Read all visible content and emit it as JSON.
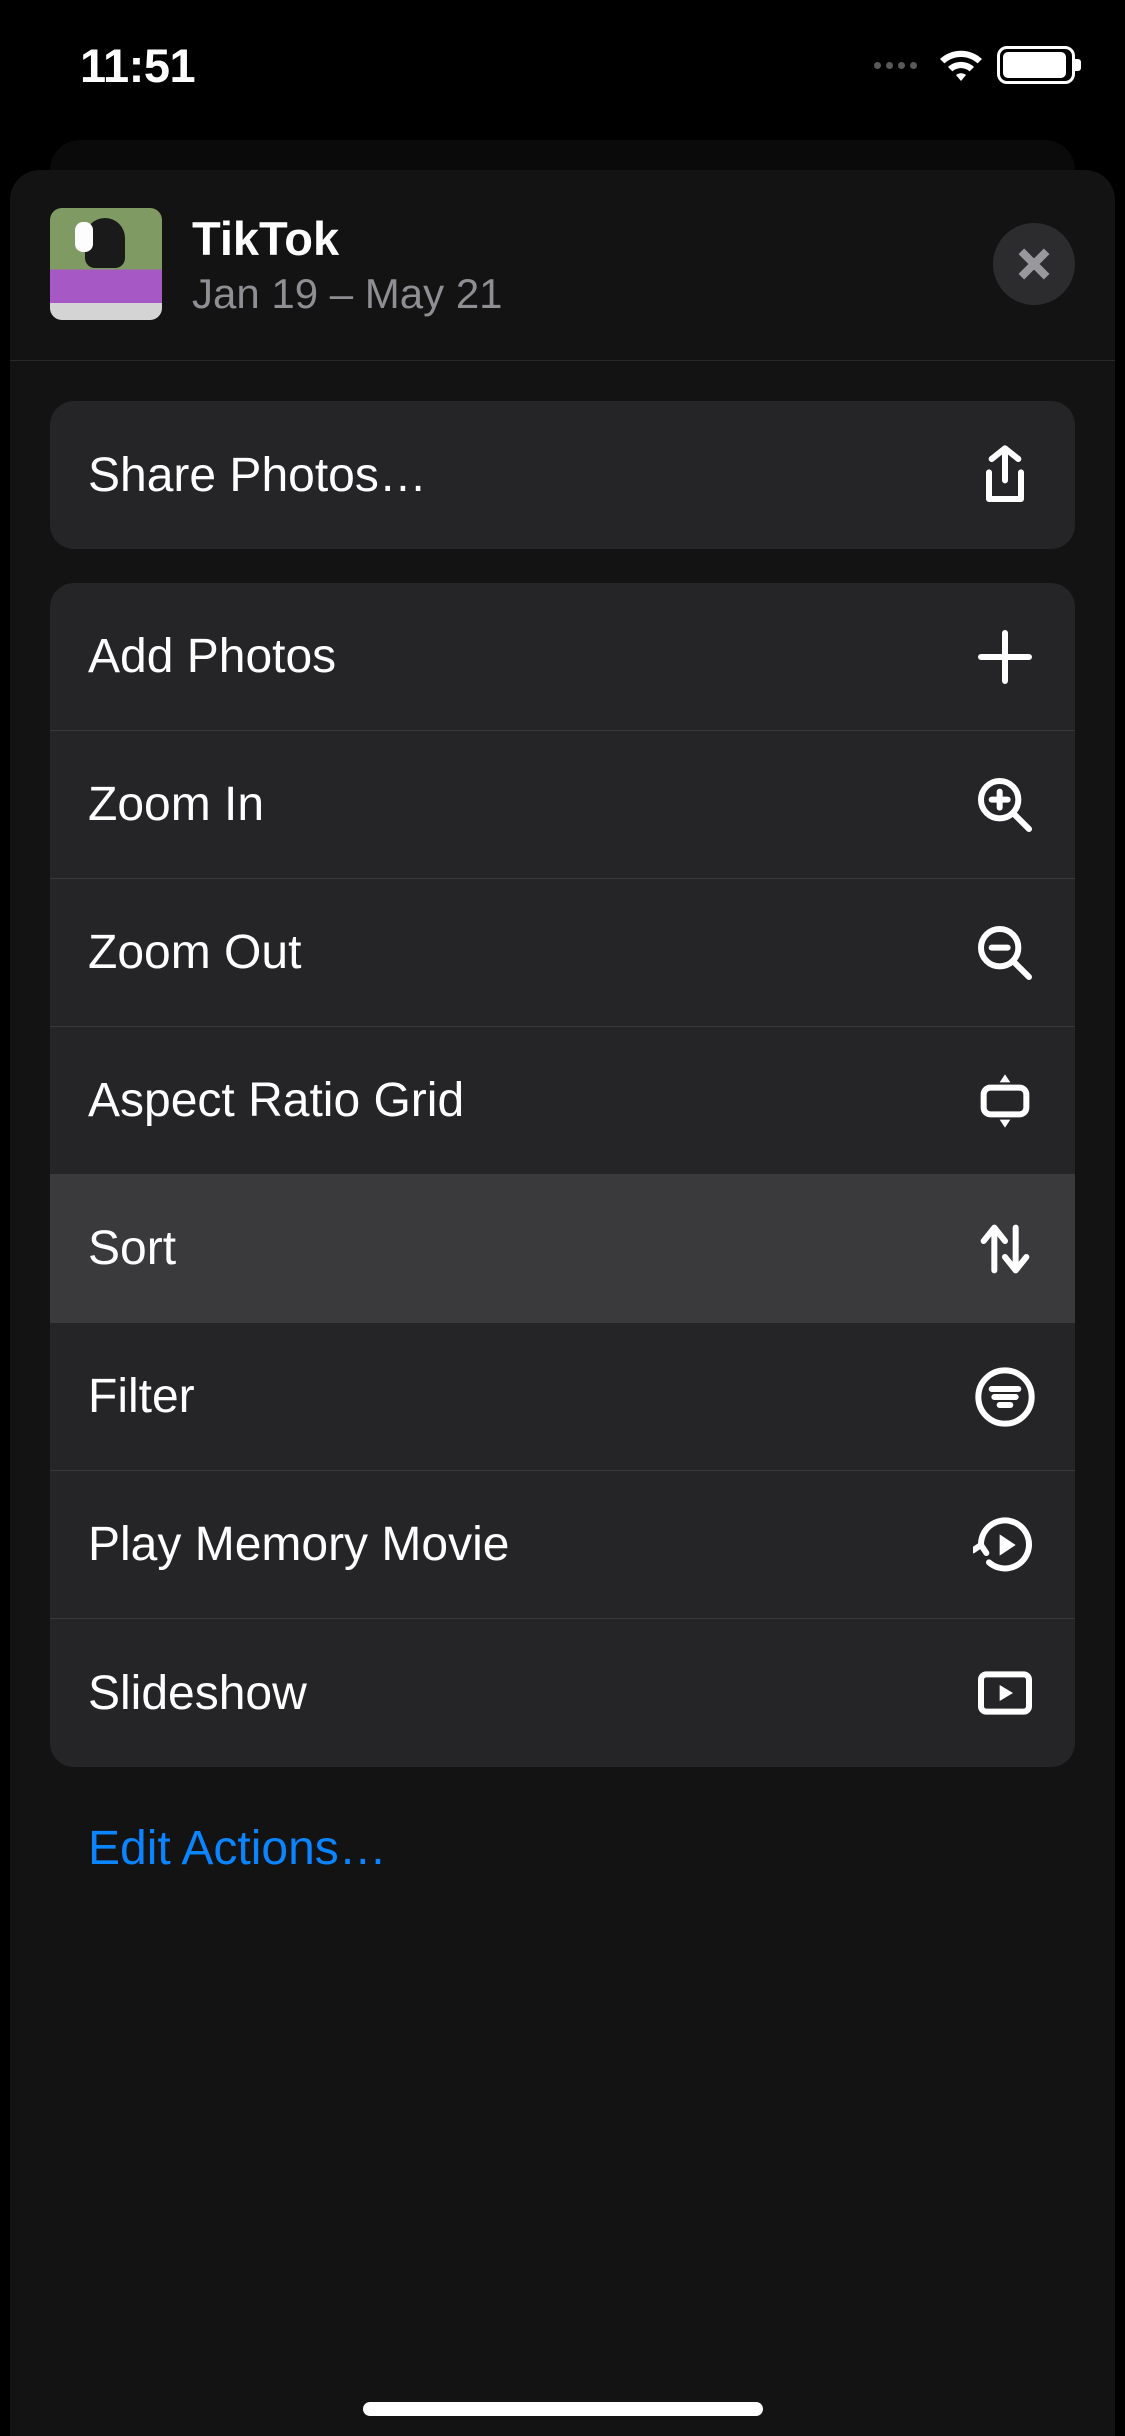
{
  "status": {
    "time": "11:51"
  },
  "header": {
    "title": "TikTok",
    "subtitle": "Jan 19 – May 21"
  },
  "share_group": {
    "share_label": "Share Photos…"
  },
  "actions_group": {
    "add_label": "Add Photos",
    "zoom_in_label": "Zoom In",
    "zoom_out_label": "Zoom Out",
    "aspect_label": "Aspect Ratio Grid",
    "sort_label": "Sort",
    "filter_label": "Filter",
    "memory_label": "Play Memory Movie",
    "slideshow_label": "Slideshow"
  },
  "footer": {
    "edit_label": "Edit Actions…"
  }
}
